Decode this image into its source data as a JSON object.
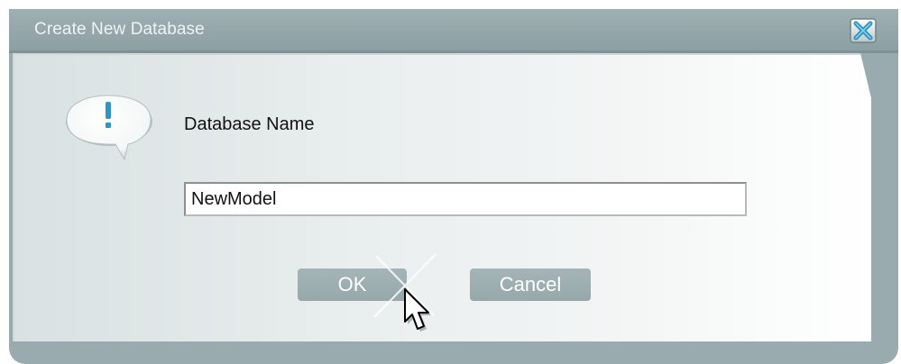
{
  "dialog": {
    "title": "Create New Database",
    "prompt_label": "Database Name",
    "name_value": "NewModel",
    "ok_label": "OK",
    "cancel_label": "Cancel"
  },
  "icons": {
    "close": "close-x-icon",
    "message": "exclamation-speech-bubble-icon",
    "cursor": "arrow-pointer-icon"
  },
  "colors": {
    "frame": "#9aabb0",
    "button": "#9eb0b3",
    "accent_blue": "#2e8fb8"
  }
}
